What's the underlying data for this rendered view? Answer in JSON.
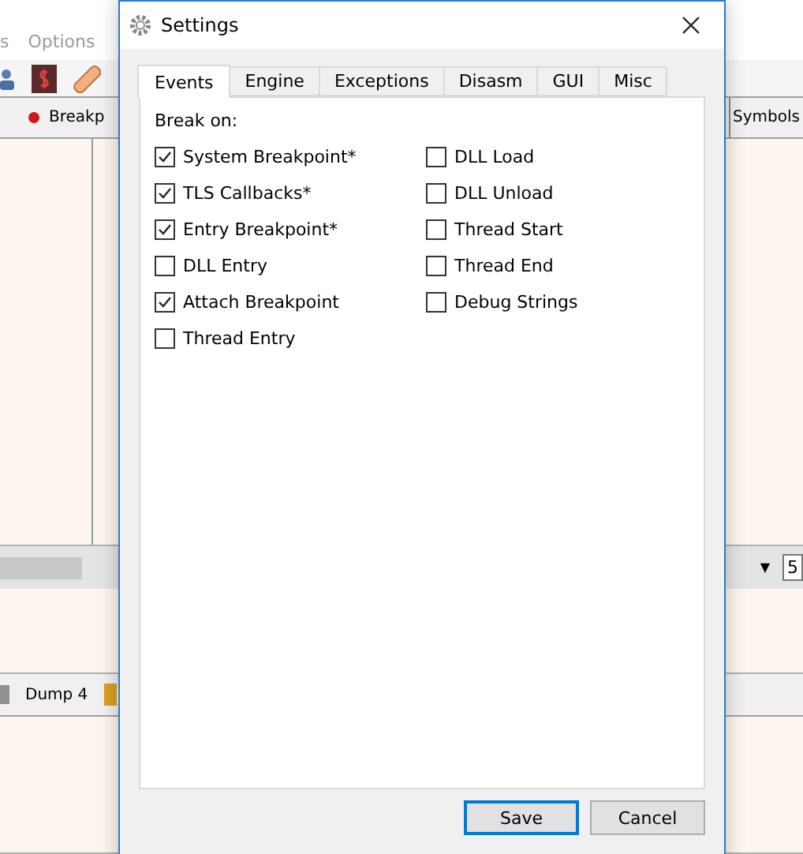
{
  "background_app": {
    "menu": [
      "s",
      "Options"
    ],
    "tabs_top": [
      {
        "label": "Breakp",
        "kind": "breakpoint"
      },
      {
        "label": "Symbols",
        "kind": "plain"
      }
    ],
    "dropdown_arrow": "▼",
    "tabs_bottom": [
      {
        "label": "Dump 4"
      }
    ],
    "spin_value": "5"
  },
  "dialog": {
    "title": "Settings",
    "tabs": [
      {
        "label": "Events",
        "selected": true
      },
      {
        "label": "Engine",
        "selected": false
      },
      {
        "label": "Exceptions",
        "selected": false
      },
      {
        "label": "Disasm",
        "selected": false
      },
      {
        "label": "GUI",
        "selected": false
      },
      {
        "label": "Misc",
        "selected": false
      }
    ],
    "group_label": "Break on:",
    "columns": [
      [
        {
          "label": "System Breakpoint*",
          "checked": true
        },
        {
          "label": "TLS Callbacks*",
          "checked": true
        },
        {
          "label": "Entry Breakpoint*",
          "checked": true
        },
        {
          "label": "DLL Entry",
          "checked": false
        },
        {
          "label": "Attach Breakpoint",
          "checked": true
        },
        {
          "label": "Thread Entry",
          "checked": false
        }
      ],
      [
        {
          "label": "DLL Load",
          "checked": false
        },
        {
          "label": "DLL Unload",
          "checked": false
        },
        {
          "label": "Thread Start",
          "checked": false
        },
        {
          "label": "Thread End",
          "checked": false
        },
        {
          "label": "Debug Strings",
          "checked": false
        }
      ]
    ],
    "buttons": [
      {
        "label": "Save",
        "default": true
      },
      {
        "label": "Cancel",
        "default": false
      }
    ]
  }
}
